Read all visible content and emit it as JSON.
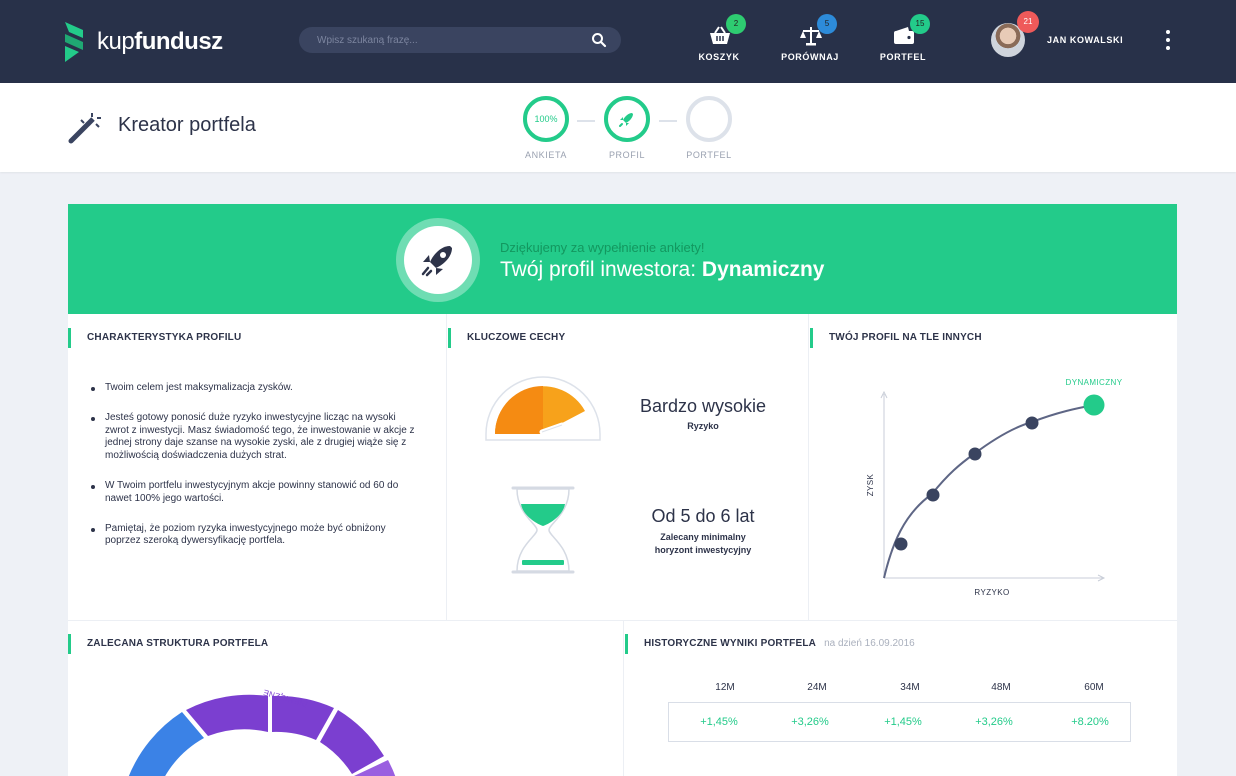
{
  "app": {
    "logo_prefix": "kup",
    "logo_suffix": "fundusz"
  },
  "search": {
    "placeholder": "Wpisz szukaną frazę..."
  },
  "nav": [
    {
      "label": "KOSZYK",
      "badge": "2",
      "badge_color": "#2ecc71",
      "icon": "basket-icon"
    },
    {
      "label": "PORÓWNAJ",
      "badge": "5",
      "badge_color": "#2d8bd9",
      "icon": "scales-icon"
    },
    {
      "label": "PORTFEL",
      "badge": "15",
      "badge_color": "#23cb8a",
      "icon": "wallet-icon"
    }
  ],
  "user": {
    "name": "JAN KOWALSKI",
    "badge": "21",
    "badge_color": "#ef5a5a"
  },
  "page": {
    "title": "Kreator portfela"
  },
  "steps": [
    {
      "label": "ANKIETA",
      "value": "100%",
      "state": "done"
    },
    {
      "label": "PROFIL",
      "value": "",
      "state": "done",
      "icon": "rocket-icon"
    },
    {
      "label": "PORTFEL",
      "value": "",
      "state": "pending"
    }
  ],
  "banner": {
    "subtitle": "Dziękujemy za wypełnienie ankiety!",
    "title_prefix": "Twój profil inwestora: ",
    "title_value": "Dynamiczny"
  },
  "characteristics": {
    "title": "CHARAKTERYSTYKA PROFILU",
    "bullets": [
      "Twoim celem jest maksymalizacja zysków.",
      "Jesteś gotowy ponosić duże ryzyko inwestycyjne licząc na wysoki zwrot z inwestycji. Masz świadomość tego, że inwestowanie w akcje z jednej strony daje szanse na wysokie zyski, ale z drugiej wiąże się z możliwością doświadczenia dużych strat.",
      "W Twoim portfelu inwestycyjnym akcje powinny stanowić od 60 do nawet 100% jego wartości.",
      "Pamiętaj, że poziom ryzyka inwestycyjnego może być obniżony poprzez szeroką dywersyfikację portfela."
    ]
  },
  "features": {
    "title": "KLUCZOWE CECHY",
    "risk_value": "Bardzo wysokie",
    "risk_caption": "Ryzyko",
    "risk_level": 0.85,
    "horizon_value": "Od 5 do 6 lat",
    "horizon_caption_1": "Zalecany minimalny",
    "horizon_caption_2": "horyzont inwestycyjny"
  },
  "comparison": {
    "title": "TWÓJ PROFIL NA TLE INNYCH",
    "highlight_label": "DYNAMICZNY",
    "ylabel": "ZYSK",
    "xlabel": "RYZYKO",
    "point_count": 5,
    "highlight_color": "#23cb8a"
  },
  "structure": {
    "title": "ZALECANA STRUKTURA PORTFELA",
    "segment_label": "PIENIĘŻNE"
  },
  "history": {
    "title": "HISTORYCZNE WYNIKI PORTFELA",
    "date": "na dzień 16.09.2016",
    "columns": [
      "12M",
      "24M",
      "34M",
      "48M",
      "60M"
    ],
    "values": [
      "+1,45%",
      "+3,26%",
      "+1,45%",
      "+3,26%",
      "+8.20%"
    ]
  }
}
